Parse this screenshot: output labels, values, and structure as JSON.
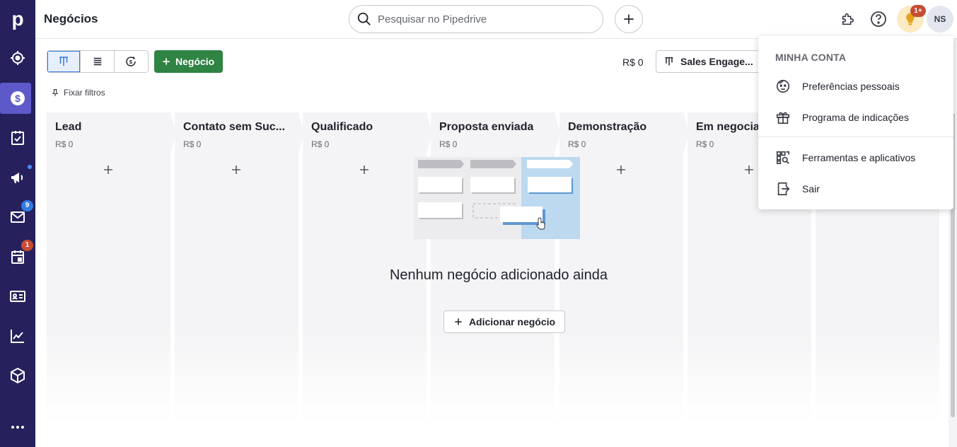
{
  "sidebar": {
    "logo": "p",
    "items": [
      {
        "name": "leads"
      },
      {
        "name": "deals",
        "active": true
      },
      {
        "name": "activities"
      },
      {
        "name": "campaigns",
        "dot": true
      },
      {
        "name": "mail",
        "badge": "9",
        "badge_color": "#317ae2"
      },
      {
        "name": "calendar",
        "badge": "1",
        "badge_color": "#c74b33"
      },
      {
        "name": "contacts"
      },
      {
        "name": "insights"
      },
      {
        "name": "products"
      },
      {
        "name": "more"
      }
    ]
  },
  "topbar": {
    "title": "Negócios",
    "search_placeholder": "Pesquisar no Pipedrive",
    "bulb_badge": "1+",
    "avatar_initials": "NS"
  },
  "toolbar": {
    "add_deal_label": "Negócio",
    "total": "R$ 0",
    "pipeline": "Sales Engage...",
    "pin_filters": "Fixar filtros"
  },
  "stages": [
    {
      "name": "Lead",
      "value": "R$ 0"
    },
    {
      "name": "Contato sem Suc...",
      "value": "R$ 0"
    },
    {
      "name": "Qualificado",
      "value": "R$ 0"
    },
    {
      "name": "Proposta enviada",
      "value": "R$ 0"
    },
    {
      "name": "Demonstração",
      "value": "R$ 0"
    },
    {
      "name": "Em negociação",
      "value": "R$ 0"
    },
    {
      "name": "",
      "value": ""
    }
  ],
  "empty_state": {
    "message": "Nenhum negócio adicionado ainda",
    "button": "Adicionar negócio"
  },
  "account_menu": {
    "header": "MINHA CONTA",
    "items": [
      {
        "label": "Preferências pessoais",
        "icon": "face-icon"
      },
      {
        "label": "Programa de indicações",
        "icon": "gift-icon"
      },
      {
        "label": "Ferramentas e aplicativos",
        "icon": "apps-icon"
      },
      {
        "label": "Sair",
        "icon": "logout-icon"
      }
    ]
  },
  "colors": {
    "sidebar": "#26215d",
    "active_nav": "#5d59c9",
    "primary_green": "#2f8343",
    "accent_blue": "#317ae2"
  }
}
